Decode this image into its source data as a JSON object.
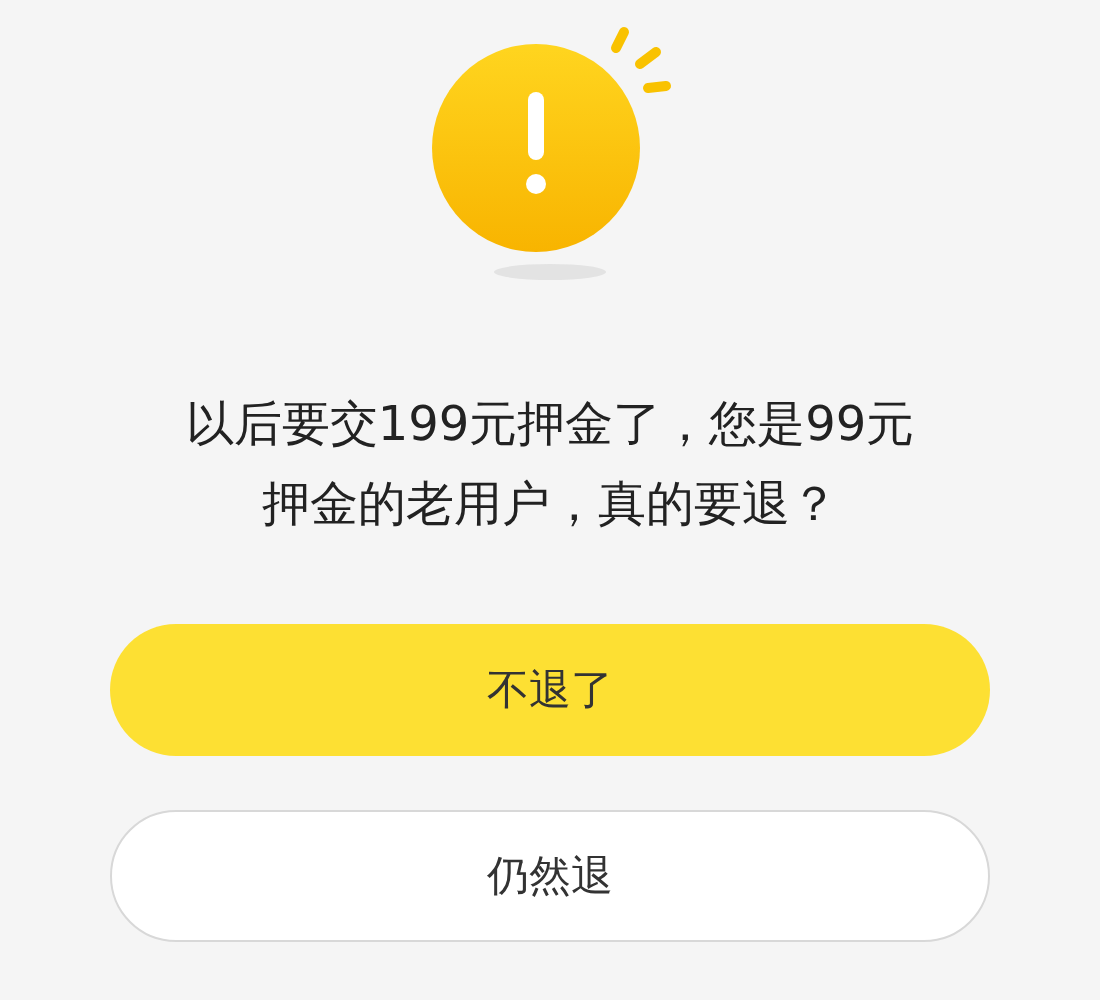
{
  "message_lines": [
    "以后要交199元押金了，您是99元",
    "押金的老用户，真的要退？"
  ],
  "buttons": [
    {
      "label": "不退了",
      "kind": "primary"
    },
    {
      "label": "仍然退",
      "kind": "secondary"
    }
  ]
}
